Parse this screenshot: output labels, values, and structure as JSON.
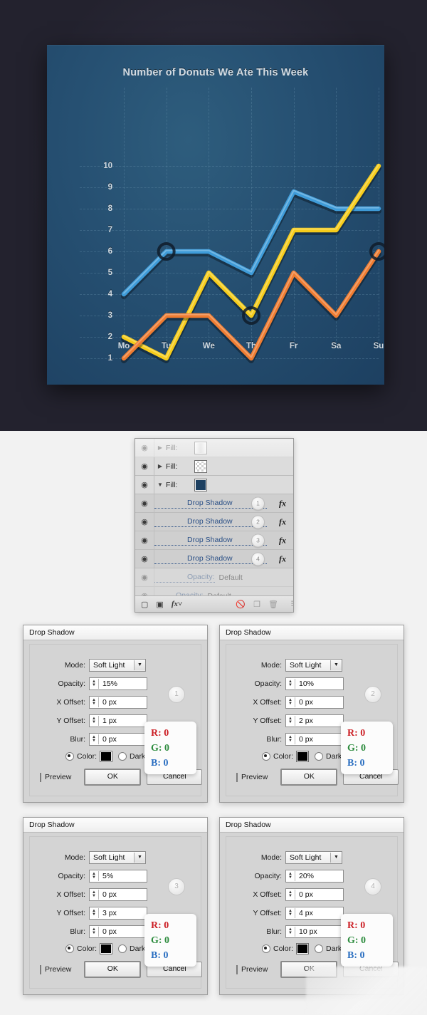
{
  "chart_data": {
    "type": "line",
    "title": "Number of Donuts We Ate This Week",
    "xlabel": "",
    "ylabel": "",
    "categories": [
      "Mo",
      "Tu",
      "We",
      "Th",
      "Fr",
      "Sa",
      "Su"
    ],
    "yticks": [
      1,
      2,
      3,
      4,
      5,
      6,
      7,
      8,
      9,
      10
    ],
    "ylim": [
      0,
      10.6
    ],
    "grid": true,
    "legend": "none",
    "series": [
      {
        "name": "blue",
        "color": "#3f9cd9",
        "values": [
          4,
          6,
          6,
          5,
          8.8,
          8,
          8
        ]
      },
      {
        "name": "yellow",
        "color": "#f6cc1b",
        "values": [
          2,
          1,
          5,
          3,
          7,
          7,
          10
        ]
      },
      {
        "name": "orange",
        "color": "#ef7c31",
        "values": [
          1,
          3,
          3,
          1,
          5,
          3,
          6
        ]
      }
    ],
    "markers": [
      {
        "series": "blue",
        "category": "Tu",
        "value": 6
      },
      {
        "series": "yellow",
        "category": "Th",
        "value": 3
      },
      {
        "series": "orange",
        "category": "Su",
        "value": 6
      }
    ],
    "colors": {
      "card_background": "#265072",
      "page_background": "#23222e",
      "grid_line": "#6f9ab5",
      "tick_label": "#cfd9e1",
      "title": "#d5dde4"
    }
  },
  "layers_panel": {
    "rows": [
      {
        "kind": "fill",
        "eye": "eye-icon",
        "triangle": "▶",
        "label": "Fill:",
        "thumb": "grad",
        "dim": true
      },
      {
        "kind": "fill",
        "eye": "eye-icon",
        "triangle": "▶",
        "label": "Fill:",
        "thumb": "checker",
        "dim": false
      },
      {
        "kind": "fill",
        "eye": "eye-icon",
        "triangle": "▼",
        "label": "Fill:",
        "thumb": "navy",
        "dim": false
      },
      {
        "kind": "fx",
        "eye": "eye-icon",
        "label": "Drop Shadow",
        "badge": "1",
        "fx": "fx",
        "dim": false
      },
      {
        "kind": "fx",
        "eye": "eye-icon",
        "label": "Drop Shadow",
        "badge": "2",
        "fx": "fx",
        "dim": false
      },
      {
        "kind": "fx",
        "eye": "eye-icon",
        "label": "Drop Shadow",
        "badge": "3",
        "fx": "fx",
        "dim": false
      },
      {
        "kind": "fx",
        "eye": "eye-icon",
        "label": "Drop Shadow",
        "badge": "4",
        "fx": "fx",
        "dim": false
      },
      {
        "kind": "opacity",
        "eye": "eye-icon",
        "label": "Opacity:",
        "value": "Default",
        "dim": true,
        "indent": 2
      },
      {
        "kind": "opacity",
        "eye": "eye-icon",
        "label": "Opacity:",
        "value": "Default",
        "dim": true,
        "indent": 1
      }
    ],
    "footer_icons": [
      "new-layer-icon",
      "new-fill-layer-icon",
      "fx-menu-icon",
      "no-selection-icon",
      "duplicate-layer-icon",
      "delete-layer-icon",
      "resize-grip-icon"
    ]
  },
  "dialogs": [
    {
      "title": "Drop Shadow",
      "number": "1",
      "mode_label": "Mode:",
      "mode_value": "Soft Light",
      "opacity_label": "Opacity:",
      "opacity_value": "15%",
      "xoffset_label": "X Offset:",
      "xoffset_value": "0 px",
      "yoffset_label": "Y Offset:",
      "yoffset_value": "1 px",
      "blur_label": "Blur:",
      "blur_value": "0 px",
      "color_label": "Color:",
      "darkness_label": "Darkness",
      "preview_label": "Preview",
      "ok_label": "OK",
      "cancel_label": "Cancel",
      "rgb": {
        "r": "R: 0",
        "g": "G: 0",
        "b": "B: 0"
      }
    },
    {
      "title": "Drop Shadow",
      "number": "2",
      "mode_label": "Mode:",
      "mode_value": "Soft Light",
      "opacity_label": "Opacity:",
      "opacity_value": "10%",
      "xoffset_label": "X Offset:",
      "xoffset_value": "0 px",
      "yoffset_label": "Y Offset:",
      "yoffset_value": "2 px",
      "blur_label": "Blur:",
      "blur_value": "0 px",
      "color_label": "Color:",
      "darkness_label": "Darkness",
      "preview_label": "Preview",
      "ok_label": "OK",
      "cancel_label": "Cancel",
      "rgb": {
        "r": "R: 0",
        "g": "G: 0",
        "b": "B: 0"
      }
    },
    {
      "title": "Drop Shadow",
      "number": "3",
      "mode_label": "Mode:",
      "mode_value": "Soft Light",
      "opacity_label": "Opacity:",
      "opacity_value": "5%",
      "xoffset_label": "X Offset:",
      "xoffset_value": "0 px",
      "yoffset_label": "Y Offset:",
      "yoffset_value": "3 px",
      "blur_label": "Blur:",
      "blur_value": "0 px",
      "color_label": "Color:",
      "darkness_label": "Darkness",
      "preview_label": "Preview",
      "ok_label": "OK",
      "cancel_label": "Cancel",
      "rgb": {
        "r": "R: 0",
        "g": "G: 0",
        "b": "B: 0"
      }
    },
    {
      "title": "Drop Shadow",
      "number": "4",
      "mode_label": "Mode:",
      "mode_value": "Soft Light",
      "opacity_label": "Opacity:",
      "opacity_value": "20%",
      "xoffset_label": "X Offset:",
      "xoffset_value": "0 px",
      "yoffset_label": "Y Offset:",
      "yoffset_value": "4 px",
      "blur_label": "Blur:",
      "blur_value": "10 px",
      "color_label": "Color:",
      "darkness_label": "Darkness",
      "preview_label": "Preview",
      "ok_label": "OK",
      "cancel_label": "Cancel",
      "rgb": {
        "r": "R: 0",
        "g": "G: 0",
        "b": "B: 0"
      }
    }
  ]
}
